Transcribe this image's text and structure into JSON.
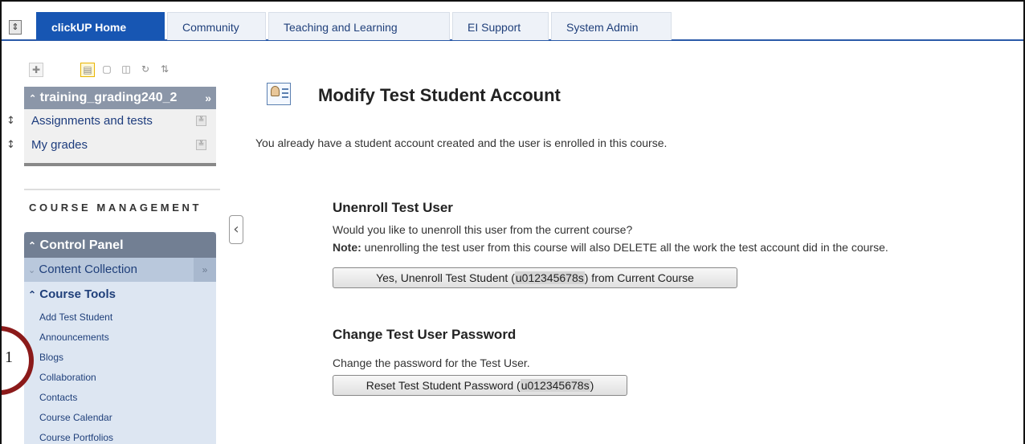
{
  "tabs": [
    {
      "label": "clickUP Home",
      "active": true
    },
    {
      "label": "Community"
    },
    {
      "label": "Teaching and Learning"
    },
    {
      "label": "EI Support"
    },
    {
      "label": "System Admin"
    }
  ],
  "sidebar": {
    "course_name": "training_grading240_2",
    "course_items": [
      {
        "label": "Assignments and tests"
      },
      {
        "label": "My grades"
      }
    ],
    "course_management_label": "COURSE MANAGEMENT",
    "control_panel_label": "Control Panel",
    "content_collection_label": "Content Collection",
    "course_tools_label": "Course Tools",
    "course_tools_items": [
      "Add Test Student",
      "Announcements",
      "Blogs",
      "Collaboration",
      "Contacts",
      "Course Calendar",
      "Course Portfolios"
    ]
  },
  "callout": {
    "number": "1"
  },
  "main": {
    "title": "Modify Test Student Account",
    "intro": "You already have a student account created and the user is enrolled in this course.",
    "unenroll": {
      "title": "Unenroll Test User",
      "question": "Would you like to unenroll this user from the current course?",
      "note_label": "Note:",
      "note_text": " unenrolling the test user from this course will also DELETE all the work the test account did in the course.",
      "button_prefix": "Yes, Unenroll Test Student (",
      "button_user": "u012345678s",
      "button_suffix": ") from Current Course"
    },
    "password": {
      "title": "Change Test User Password",
      "text": "Change the password for the Test User.",
      "button_prefix": "Reset Test Student Password (",
      "button_user": "u012345678s",
      "button_suffix": ")"
    }
  },
  "colors": {
    "tab_active": "#1756b3",
    "control_panel_header": "#727f93",
    "callout_ring": "#8b1a1a"
  }
}
